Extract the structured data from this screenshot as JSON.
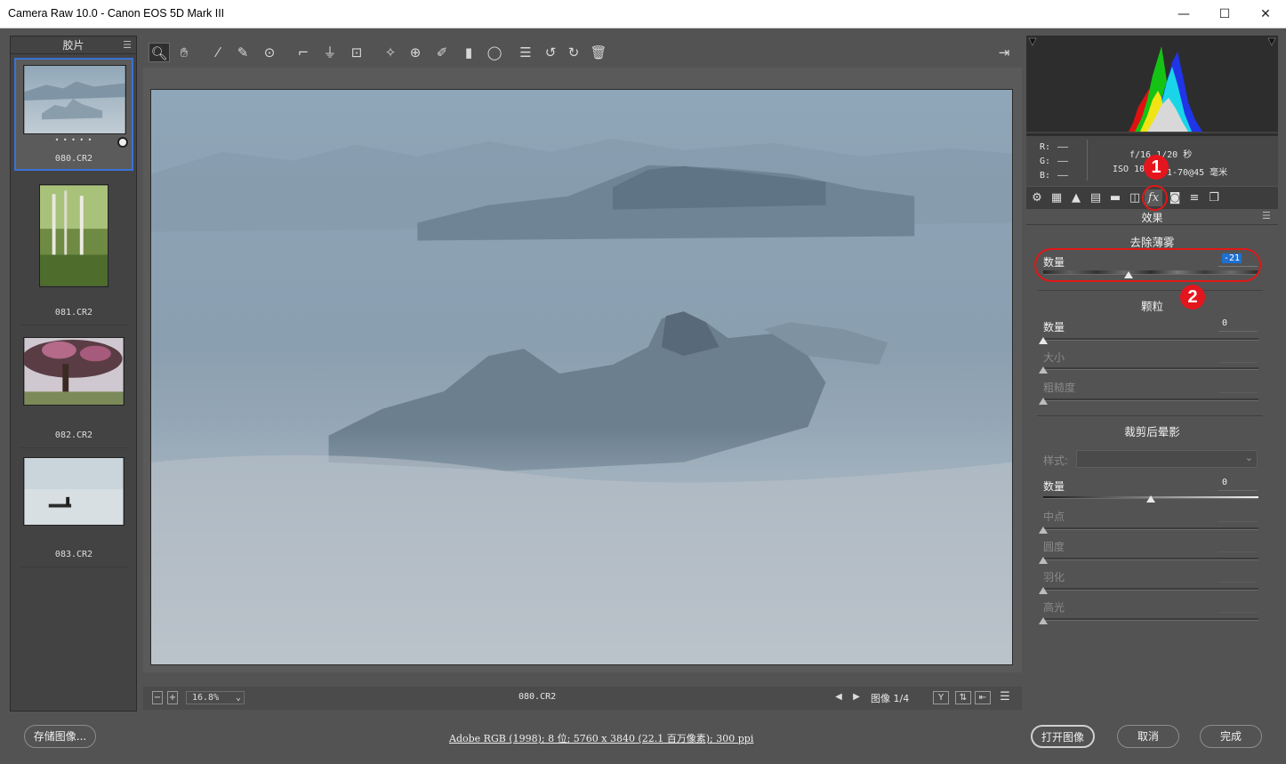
{
  "window": {
    "title": "Camera Raw 10.0 -  Canon EOS 5D Mark III",
    "minimize_icon": "minimize-icon",
    "maximize_icon": "maximize-icon",
    "close_icon": "close-icon"
  },
  "filmstrip": {
    "header": "胶片",
    "items": [
      {
        "label": "080.CR2",
        "selected": true,
        "rating_dots": "• • • • •"
      },
      {
        "label": "081.CR2"
      },
      {
        "label": "082.CR2"
      },
      {
        "label": "083.CR2"
      }
    ]
  },
  "toolbar": {
    "tools": [
      "zoom-icon",
      "hand-icon",
      "white-balance-icon",
      "color-sampler-icon",
      "targeted-adjustment-icon",
      "crop-icon",
      "straighten-icon",
      "transform-icon",
      "spot-removal-icon",
      "red-eye-icon",
      "adjustment-brush-icon",
      "graduated-filter-icon",
      "radial-filter-icon",
      "preferences-icon",
      "rotate-left-icon",
      "rotate-right-icon",
      "trash-icon"
    ],
    "fullscreen_icon": "fullscreen-icon"
  },
  "statusbar": {
    "zoom_out": "−",
    "zoom_in": "+",
    "zoom": "16.8%",
    "filename": "080.CR2",
    "prev": "◀",
    "next": "▶",
    "image_counter": "图像 1/4",
    "btn_y": "Y",
    "btn_swap": "⇅",
    "btn_copy": "⇤"
  },
  "info": {
    "r_label": "R:",
    "g_label": "G:",
    "b_label": "B:",
    "r_value": "——",
    "g_value": "——",
    "b_value": "——",
    "exposure": "f/16  1/20 秒",
    "iso_lens_a": "ISO 10",
    "iso_lens_b": "1-70@45 毫米"
  },
  "panel": {
    "title": "效果",
    "dehaze": {
      "title": "去除薄雾",
      "amount_label": "数量",
      "amount_value": "-21",
      "amount_level": 0.395
    },
    "grain": {
      "title": "颗粒",
      "amount_label": "数量",
      "amount_value": "0",
      "size_label": "大小",
      "roughness_label": "粗糙度"
    },
    "vignette": {
      "title": "裁剪后晕影",
      "style_label": "样式:",
      "amount_label": "数量",
      "amount_value": "0",
      "midpoint_label": "中点",
      "roundness_label": "圆度",
      "feather_label": "羽化",
      "highlights_label": "高光"
    }
  },
  "annotations": {
    "step1": "1",
    "step2": "2"
  },
  "bottom": {
    "save_button": "存储图像...",
    "workflow": "Adobe RGB (1998); 8 位; 5760 x 3840 (22.1 百万像素); 300 ppi",
    "open_button": "打开图像",
    "cancel_button": "取消",
    "done_button": "完成"
  },
  "colors": {
    "panel_bg": "#535353",
    "selection_blue": "#3a72d6",
    "annotation_red": "#e5151d",
    "value_highlight": "#1f6fd1"
  }
}
